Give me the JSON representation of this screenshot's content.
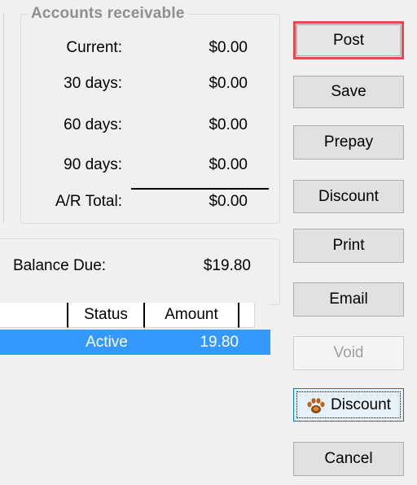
{
  "accounts_receivable": {
    "title": "Accounts receivable",
    "rows": [
      {
        "label": "Current:",
        "value": "$0.00"
      },
      {
        "label": "30 days:",
        "value": "$0.00"
      },
      {
        "label": "60 days:",
        "value": "$0.00"
      },
      {
        "label": "90 days:",
        "value": "$0.00"
      },
      {
        "label": "A/R Total:",
        "value": "$0.00"
      }
    ]
  },
  "balance": {
    "label": "Balance Due:",
    "value": "$19.80"
  },
  "grid": {
    "columns": [
      "",
      "Status",
      "Amount"
    ],
    "rows": [
      {
        "status": "Active",
        "amount": "19.80"
      }
    ]
  },
  "buttons": {
    "post": "Post",
    "save": "Save",
    "prepay": "Prepay",
    "discount": "Discount",
    "print": "Print",
    "email": "Email",
    "void": "Void",
    "paw_discount": "Discount",
    "cancel": "Cancel"
  },
  "icons": {
    "paw": "paw-icon"
  },
  "colors": {
    "selection": "#3399ff",
    "highlight_border": "#e8474b"
  }
}
